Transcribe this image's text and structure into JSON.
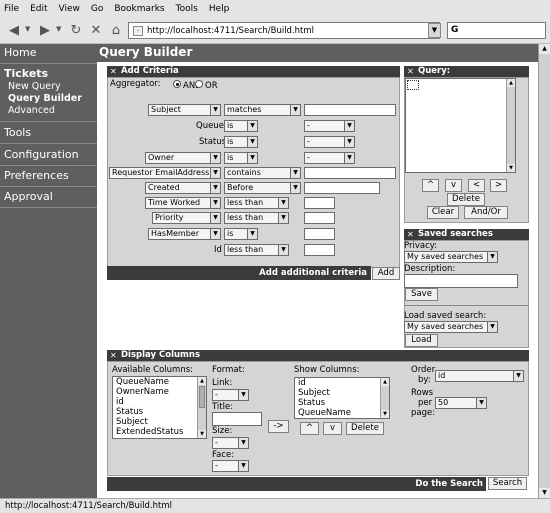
{
  "menu": [
    "File",
    "Edit",
    "View",
    "Go",
    "Bookmarks",
    "Tools",
    "Help"
  ],
  "browser": {
    "url": "http://localhost:4711/Search/Build.html",
    "search_glyph": "G",
    "status_url": "http://localhost:4711/Search/Build.html"
  },
  "sidebar": {
    "home": "Home",
    "tickets": "Tickets",
    "new_query": "New Query",
    "query_builder": "Query Builder",
    "advanced": "Advanced",
    "tools": "Tools",
    "configuration": "Configuration",
    "preferences": "Preferences",
    "approval": "Approval"
  },
  "page_title": "Query Builder",
  "criteria": {
    "title": "Add Criteria",
    "aggregator_label": "Aggregator:",
    "and_label": "AND",
    "or_label": "OR",
    "rows": [
      {
        "field": "Subject",
        "op": "matches",
        "value": ""
      },
      {
        "field": "Queue",
        "op": "is",
        "value": "-"
      },
      {
        "field": "Status",
        "op": "is",
        "value": "-"
      },
      {
        "field": "Owner",
        "op": "is",
        "value": "-"
      },
      {
        "field": "Requestor EmailAddress",
        "op": "contains",
        "value": ""
      },
      {
        "field": "Created",
        "op": "Before",
        "value": ""
      },
      {
        "field": "Time Worked",
        "op": "less than",
        "value": ""
      },
      {
        "field": "Priority",
        "op": "less than",
        "value": ""
      },
      {
        "field": "HasMember",
        "op": "is",
        "value": ""
      },
      {
        "field": "Id",
        "op": "less than",
        "value": ""
      }
    ],
    "add_text": "Add additional criteria",
    "add_button": "Add"
  },
  "query": {
    "title": "Query:",
    "up": "^",
    "down": "v",
    "left": "<",
    "right": ">",
    "delete": "Delete",
    "clear": "Clear",
    "andor": "And/Or"
  },
  "saved": {
    "title": "Saved searches",
    "privacy_label": "Privacy:",
    "privacy_value": "My saved searches",
    "description_label": "Description:",
    "save_button": "Save",
    "load_label": "Load saved search:",
    "load_value": "My saved searches",
    "load_button": "Load"
  },
  "columns": {
    "title": "Display Columns",
    "available_label": "Available Columns:",
    "available": [
      "QueueName",
      "OwnerName",
      "id",
      "Status",
      "Subject",
      "ExtendedStatus"
    ],
    "format_label": "Format:",
    "link_label": "Link:",
    "link_value": "-",
    "title_label": "Title:",
    "size_label": "Size:",
    "size_value": "-",
    "face_label": "Face:",
    "face_value": "-",
    "add_arrow": "->",
    "show_label": "Show Columns:",
    "show": [
      "id",
      "Subject",
      "Status",
      "QueueName"
    ],
    "up": "^",
    "down": "v",
    "delete": "Delete",
    "order_label_1": "Order",
    "order_label_2": "by:",
    "order_value": "id",
    "rows_label_1": "Rows",
    "rows_label_2": "per",
    "rows_label_3": "page:",
    "rows_value": "50",
    "do_search": "Do the Search",
    "search_button": "Search"
  }
}
